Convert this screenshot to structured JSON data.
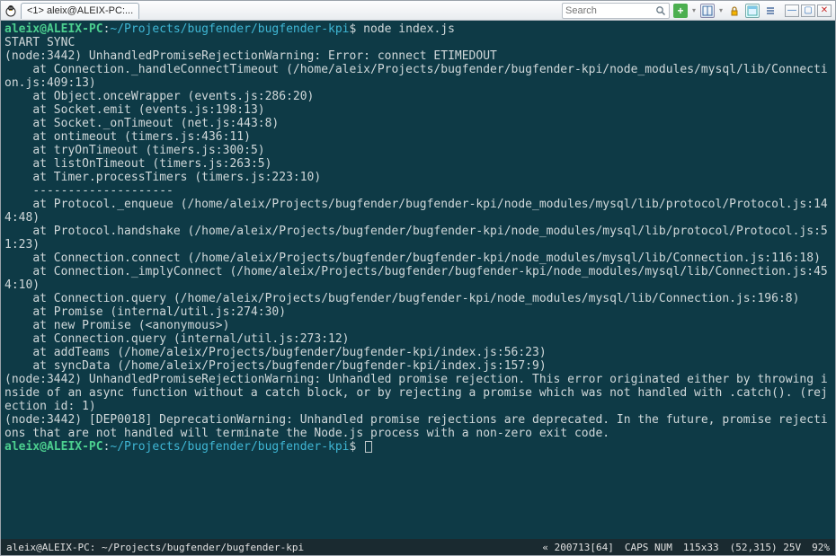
{
  "title": {
    "app_tab": "<1> aleix@ALEIX-PC:..."
  },
  "toolbar": {
    "search_placeholder": "Search",
    "plus_tooltip": "+",
    "panes_tooltip": "panes",
    "lock_tooltip": "lock",
    "list_tooltip": "list",
    "minimize_label": "—",
    "maximize_label": "▢",
    "close_label": "✕"
  },
  "terminal": {
    "prompt": {
      "user_host": "aleix@ALEIX-PC",
      "colon": ":",
      "path": "~/Projects/bugfender/bugfender-kpi",
      "dollar": "$"
    },
    "command": "node index.js",
    "lines": [
      "START SYNC",
      "(node:3442) UnhandledPromiseRejectionWarning: Error: connect ETIMEDOUT",
      "    at Connection._handleConnectTimeout (/home/aleix/Projects/bugfender/bugfender-kpi/node_modules/mysql/lib/Connection.js:409:13)",
      "    at Object.onceWrapper (events.js:286:20)",
      "    at Socket.emit (events.js:198:13)",
      "    at Socket._onTimeout (net.js:443:8)",
      "    at ontimeout (timers.js:436:11)",
      "    at tryOnTimeout (timers.js:300:5)",
      "    at listOnTimeout (timers.js:263:5)",
      "    at Timer.processTimers (timers.js:223:10)",
      "    --------------------",
      "    at Protocol._enqueue (/home/aleix/Projects/bugfender/bugfender-kpi/node_modules/mysql/lib/protocol/Protocol.js:144:48)",
      "    at Protocol.handshake (/home/aleix/Projects/bugfender/bugfender-kpi/node_modules/mysql/lib/protocol/Protocol.js:51:23)",
      "    at Connection.connect (/home/aleix/Projects/bugfender/bugfender-kpi/node_modules/mysql/lib/Connection.js:116:18)",
      "    at Connection._implyConnect (/home/aleix/Projects/bugfender/bugfender-kpi/node_modules/mysql/lib/Connection.js:454:10)",
      "    at Connection.query (/home/aleix/Projects/bugfender/bugfender-kpi/node_modules/mysql/lib/Connection.js:196:8)",
      "    at Promise (internal/util.js:274:30)",
      "    at new Promise (<anonymous>)",
      "    at Connection.query (internal/util.js:273:12)",
      "    at addTeams (/home/aleix/Projects/bugfender/bugfender-kpi/index.js:56:23)",
      "    at syncData (/home/aleix/Projects/bugfender/bugfender-kpi/index.js:157:9)",
      "(node:3442) UnhandledPromiseRejectionWarning: Unhandled promise rejection. This error originated either by throwing inside of an async function without a catch block, or by rejecting a promise which was not handled with .catch(). (rejection id: 1)",
      "(node:3442) [DEP0018] DeprecationWarning: Unhandled promise rejections are deprecated. In the future, promise rejections that are not handled will terminate the Node.js process with a non-zero exit code."
    ]
  },
  "statusbar": {
    "left": "aleix@ALEIX-PC: ~/Projects/bugfender/bugfender-kpi",
    "encoding": "« 200713[64]",
    "caps": "CAPS NUM",
    "size": "115x33",
    "pos": "(52,315) 25V",
    "pct": "92%"
  }
}
